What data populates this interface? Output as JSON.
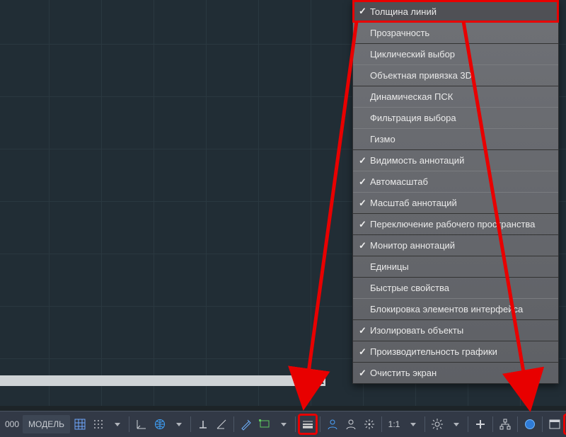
{
  "coord_value": "000",
  "model_label": "МОДЕЛЬ",
  "scale_label": "1:1",
  "menu": {
    "items": [
      {
        "label": "Толщина линий",
        "checked": true,
        "selected": true,
        "group_start": false
      },
      {
        "label": "Прозрачность",
        "checked": false,
        "selected": false,
        "group_start": false
      },
      {
        "label": "Циклический выбор",
        "checked": false,
        "selected": false,
        "group_start": true
      },
      {
        "label": "Объектная привязка 3D",
        "checked": false,
        "selected": false,
        "group_start": false
      },
      {
        "label": "Динамическая ПСК",
        "checked": false,
        "selected": false,
        "group_start": true
      },
      {
        "label": "Фильтрация выбора",
        "checked": false,
        "selected": false,
        "group_start": false
      },
      {
        "label": "Гизмо",
        "checked": false,
        "selected": false,
        "group_start": false
      },
      {
        "label": "Видимость аннотаций",
        "checked": true,
        "selected": false,
        "group_start": true
      },
      {
        "label": "Автомасштаб",
        "checked": true,
        "selected": false,
        "group_start": false
      },
      {
        "label": "Масштаб аннотаций",
        "checked": true,
        "selected": false,
        "group_start": false
      },
      {
        "label": "Переключение рабочего пространства",
        "checked": true,
        "selected": false,
        "group_start": true
      },
      {
        "label": "Монитор аннотаций",
        "checked": true,
        "selected": false,
        "group_start": true
      },
      {
        "label": "Единицы",
        "checked": false,
        "selected": false,
        "group_start": true
      },
      {
        "label": "Быстрые свойства",
        "checked": false,
        "selected": false,
        "group_start": true
      },
      {
        "label": "Блокировка элементов интерфейса",
        "checked": false,
        "selected": false,
        "group_start": false
      },
      {
        "label": "Изолировать объекты",
        "checked": true,
        "selected": false,
        "group_start": true
      },
      {
        "label": "Производительность графики",
        "checked": true,
        "selected": false,
        "group_start": true
      },
      {
        "label": "Очистить экран",
        "checked": true,
        "selected": false,
        "group_start": true
      }
    ]
  },
  "statusbar_icons": [
    "grid-display-icon",
    "grid-dots-icon",
    "dropdown-icon",
    "sep",
    "ucs-icon",
    "globe-icon",
    "dropdown-icon",
    "sep",
    "perpendicular-icon",
    "angle-icon",
    "sep",
    "draft-icon",
    "rectangle-icon",
    "dropdown-icon",
    "sep",
    "lineweight-icon",
    "sep",
    "person-icon",
    "person2-icon",
    "spread-icon",
    "sep",
    "scale-label",
    "dropdown-icon",
    "sep",
    "gear-icon",
    "dropdown-icon",
    "sep",
    "plus-icon",
    "sep",
    "tree-icon",
    "sep",
    "circle-icon",
    "sep",
    "window-icon",
    "hamburger-icon"
  ]
}
